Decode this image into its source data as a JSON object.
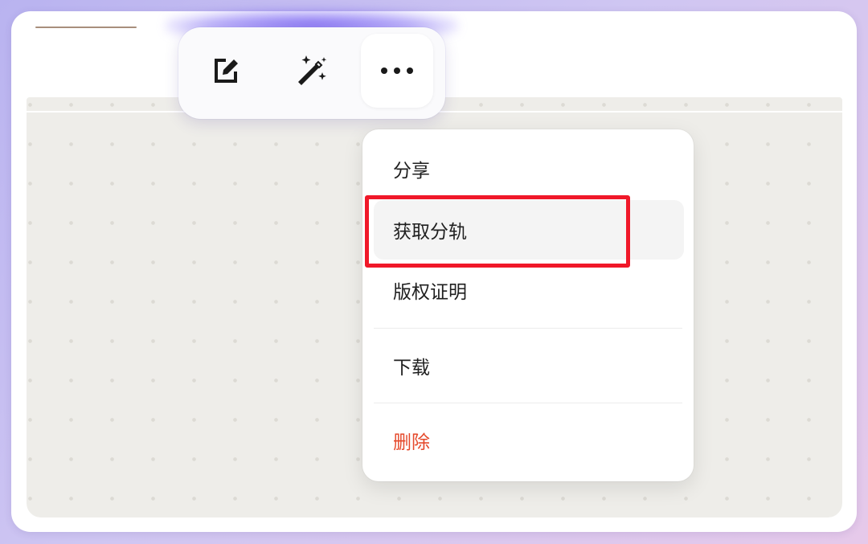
{
  "toolbar": {
    "buttons": [
      {
        "id": "edit",
        "icon": "edit-icon"
      },
      {
        "id": "magic",
        "icon": "magic-wand-icon"
      },
      {
        "id": "more",
        "icon": "more-icon",
        "active": true
      }
    ]
  },
  "menu": {
    "items": [
      {
        "id": "share",
        "label": "分享"
      },
      {
        "id": "get-stems",
        "label": "获取分轨",
        "highlighted": true
      },
      {
        "id": "copyright-certificate",
        "label": "版权证明"
      },
      {
        "id": "download",
        "label": "下载"
      },
      {
        "id": "delete",
        "label": "删除",
        "danger": true
      }
    ]
  },
  "colors": {
    "danger": "#e5492b",
    "highlight_box": "#f01829",
    "canvas_bg": "#eeede9",
    "accent_glow": "#7660f0"
  }
}
